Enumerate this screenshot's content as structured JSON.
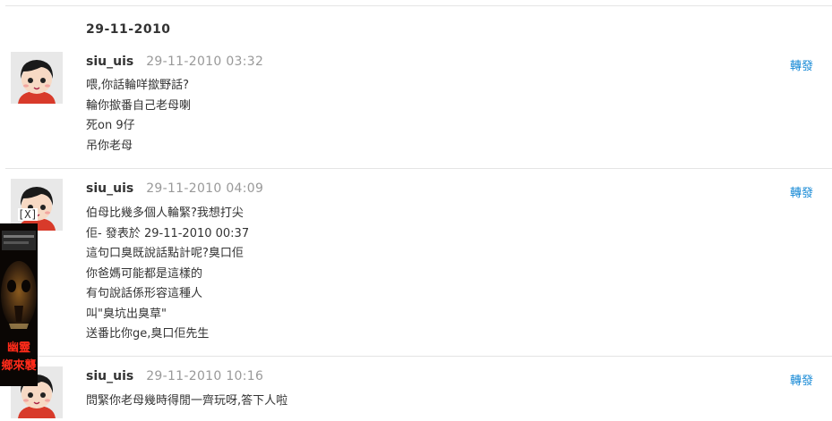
{
  "date_header": "29-11-2010",
  "repost_label": "轉發",
  "posts": [
    {
      "username": "siu_uis",
      "timestamp": "29-11-2010 03:32",
      "lines": [
        "喂,你話輪咩撳野話?",
        "輪你撳番自己老母喇",
        "死on 9仔",
        "吊你老母"
      ]
    },
    {
      "username": "siu_uis",
      "timestamp": "29-11-2010 04:09",
      "lines": [
        "伯母比幾多個人輪緊?我想打尖",
        "佢- 發表於 29-11-2010 00:37",
        "這句口臭既說話點計呢?臭口佢",
        "你爸媽可能都是這樣的",
        "有句說話係形容這種人",
        "叫\"臭坑出臭草\"",
        "送番比你ge,臭口佢先生"
      ]
    },
    {
      "username": "siu_uis",
      "timestamp": "29-11-2010 10:16",
      "lines": [
        "問緊你老母幾時得閒一齊玩呀,答下人啦"
      ]
    }
  ],
  "ad": {
    "close_label": "[X]",
    "text_line1": "幽靈",
    "text_line2": "鄉來襲"
  }
}
